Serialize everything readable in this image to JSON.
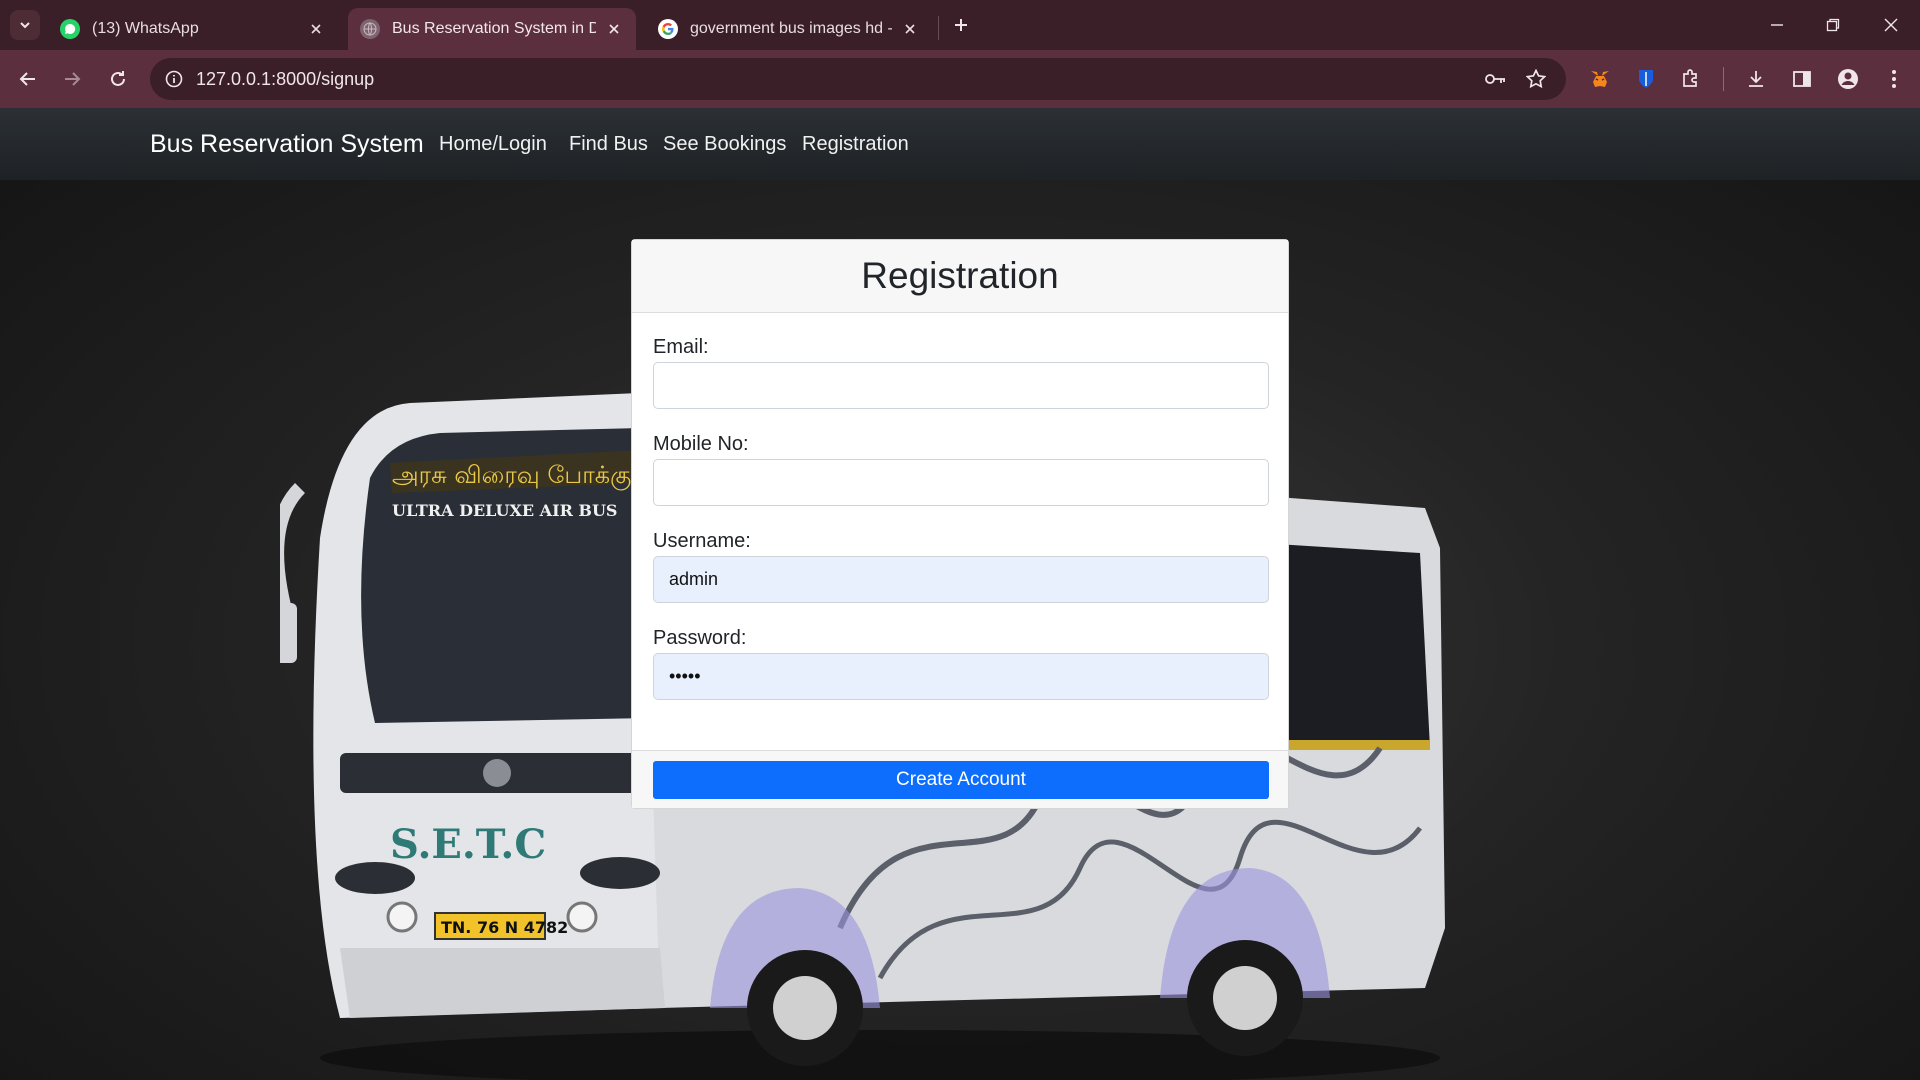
{
  "browser": {
    "tabs": [
      {
        "title": "(13) WhatsApp",
        "icon": "whatsapp-icon",
        "active": false
      },
      {
        "title": "Bus Reservation System in Djan",
        "icon": "globe-icon",
        "active": true
      },
      {
        "title": "government bus images hd - Go",
        "icon": "google-icon",
        "active": false
      }
    ],
    "url": "127.0.0.1:8000/signup",
    "colors": {
      "frame": "#3a1f28",
      "toolbar": "#5b2f3e"
    }
  },
  "navbar": {
    "brand": "Bus Reservation System",
    "links": [
      "Home/Login",
      "Find Bus",
      "See Bookings",
      "Registration"
    ]
  },
  "background": {
    "bus_text": "அரசு விரைவு போக்குவரத்து",
    "bus_subtext": "ULTRA DELUXE   AIR BUS",
    "bus_logo": "S.E.T.C",
    "plate": "TN. 76 N 4782"
  },
  "form": {
    "title": "Registration",
    "fields": [
      {
        "label": "Email:",
        "value": ""
      },
      {
        "label": "Mobile No:",
        "value": ""
      },
      {
        "label": "Username:",
        "value": "admin"
      },
      {
        "label": "Password:",
        "value": "•••••"
      }
    ],
    "submit_label": "Create Account",
    "accent": "#0d6efd"
  }
}
